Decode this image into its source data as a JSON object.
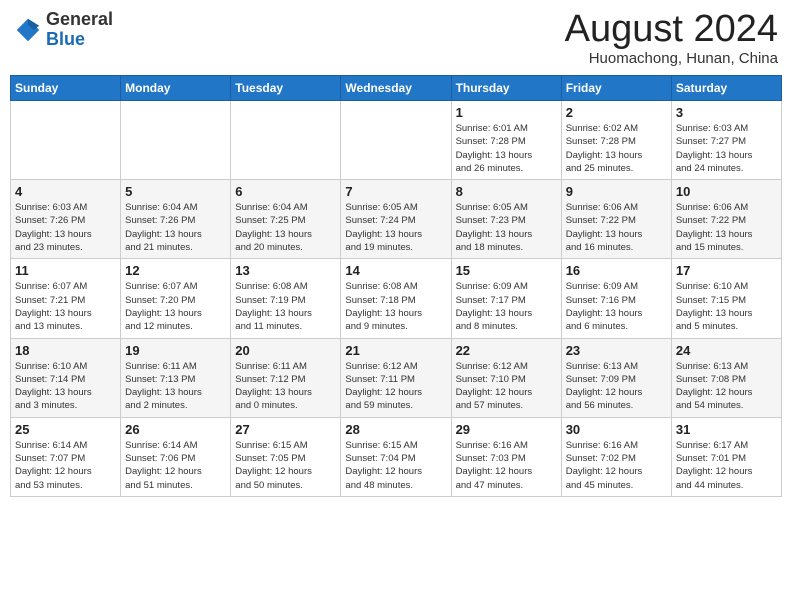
{
  "header": {
    "logo_general": "General",
    "logo_blue": "Blue",
    "month_year": "August 2024",
    "location": "Huomachong, Hunan, China"
  },
  "days_of_week": [
    "Sunday",
    "Monday",
    "Tuesday",
    "Wednesday",
    "Thursday",
    "Friday",
    "Saturday"
  ],
  "weeks": [
    [
      {
        "day": "",
        "info": ""
      },
      {
        "day": "",
        "info": ""
      },
      {
        "day": "",
        "info": ""
      },
      {
        "day": "",
        "info": ""
      },
      {
        "day": "1",
        "info": "Sunrise: 6:01 AM\nSunset: 7:28 PM\nDaylight: 13 hours\nand 26 minutes."
      },
      {
        "day": "2",
        "info": "Sunrise: 6:02 AM\nSunset: 7:28 PM\nDaylight: 13 hours\nand 25 minutes."
      },
      {
        "day": "3",
        "info": "Sunrise: 6:03 AM\nSunset: 7:27 PM\nDaylight: 13 hours\nand 24 minutes."
      }
    ],
    [
      {
        "day": "4",
        "info": "Sunrise: 6:03 AM\nSunset: 7:26 PM\nDaylight: 13 hours\nand 23 minutes."
      },
      {
        "day": "5",
        "info": "Sunrise: 6:04 AM\nSunset: 7:26 PM\nDaylight: 13 hours\nand 21 minutes."
      },
      {
        "day": "6",
        "info": "Sunrise: 6:04 AM\nSunset: 7:25 PM\nDaylight: 13 hours\nand 20 minutes."
      },
      {
        "day": "7",
        "info": "Sunrise: 6:05 AM\nSunset: 7:24 PM\nDaylight: 13 hours\nand 19 minutes."
      },
      {
        "day": "8",
        "info": "Sunrise: 6:05 AM\nSunset: 7:23 PM\nDaylight: 13 hours\nand 18 minutes."
      },
      {
        "day": "9",
        "info": "Sunrise: 6:06 AM\nSunset: 7:22 PM\nDaylight: 13 hours\nand 16 minutes."
      },
      {
        "day": "10",
        "info": "Sunrise: 6:06 AM\nSunset: 7:22 PM\nDaylight: 13 hours\nand 15 minutes."
      }
    ],
    [
      {
        "day": "11",
        "info": "Sunrise: 6:07 AM\nSunset: 7:21 PM\nDaylight: 13 hours\nand 13 minutes."
      },
      {
        "day": "12",
        "info": "Sunrise: 6:07 AM\nSunset: 7:20 PM\nDaylight: 13 hours\nand 12 minutes."
      },
      {
        "day": "13",
        "info": "Sunrise: 6:08 AM\nSunset: 7:19 PM\nDaylight: 13 hours\nand 11 minutes."
      },
      {
        "day": "14",
        "info": "Sunrise: 6:08 AM\nSunset: 7:18 PM\nDaylight: 13 hours\nand 9 minutes."
      },
      {
        "day": "15",
        "info": "Sunrise: 6:09 AM\nSunset: 7:17 PM\nDaylight: 13 hours\nand 8 minutes."
      },
      {
        "day": "16",
        "info": "Sunrise: 6:09 AM\nSunset: 7:16 PM\nDaylight: 13 hours\nand 6 minutes."
      },
      {
        "day": "17",
        "info": "Sunrise: 6:10 AM\nSunset: 7:15 PM\nDaylight: 13 hours\nand 5 minutes."
      }
    ],
    [
      {
        "day": "18",
        "info": "Sunrise: 6:10 AM\nSunset: 7:14 PM\nDaylight: 13 hours\nand 3 minutes."
      },
      {
        "day": "19",
        "info": "Sunrise: 6:11 AM\nSunset: 7:13 PM\nDaylight: 13 hours\nand 2 minutes."
      },
      {
        "day": "20",
        "info": "Sunrise: 6:11 AM\nSunset: 7:12 PM\nDaylight: 13 hours\nand 0 minutes."
      },
      {
        "day": "21",
        "info": "Sunrise: 6:12 AM\nSunset: 7:11 PM\nDaylight: 12 hours\nand 59 minutes."
      },
      {
        "day": "22",
        "info": "Sunrise: 6:12 AM\nSunset: 7:10 PM\nDaylight: 12 hours\nand 57 minutes."
      },
      {
        "day": "23",
        "info": "Sunrise: 6:13 AM\nSunset: 7:09 PM\nDaylight: 12 hours\nand 56 minutes."
      },
      {
        "day": "24",
        "info": "Sunrise: 6:13 AM\nSunset: 7:08 PM\nDaylight: 12 hours\nand 54 minutes."
      }
    ],
    [
      {
        "day": "25",
        "info": "Sunrise: 6:14 AM\nSunset: 7:07 PM\nDaylight: 12 hours\nand 53 minutes."
      },
      {
        "day": "26",
        "info": "Sunrise: 6:14 AM\nSunset: 7:06 PM\nDaylight: 12 hours\nand 51 minutes."
      },
      {
        "day": "27",
        "info": "Sunrise: 6:15 AM\nSunset: 7:05 PM\nDaylight: 12 hours\nand 50 minutes."
      },
      {
        "day": "28",
        "info": "Sunrise: 6:15 AM\nSunset: 7:04 PM\nDaylight: 12 hours\nand 48 minutes."
      },
      {
        "day": "29",
        "info": "Sunrise: 6:16 AM\nSunset: 7:03 PM\nDaylight: 12 hours\nand 47 minutes."
      },
      {
        "day": "30",
        "info": "Sunrise: 6:16 AM\nSunset: 7:02 PM\nDaylight: 12 hours\nand 45 minutes."
      },
      {
        "day": "31",
        "info": "Sunrise: 6:17 AM\nSunset: 7:01 PM\nDaylight: 12 hours\nand 44 minutes."
      }
    ]
  ]
}
